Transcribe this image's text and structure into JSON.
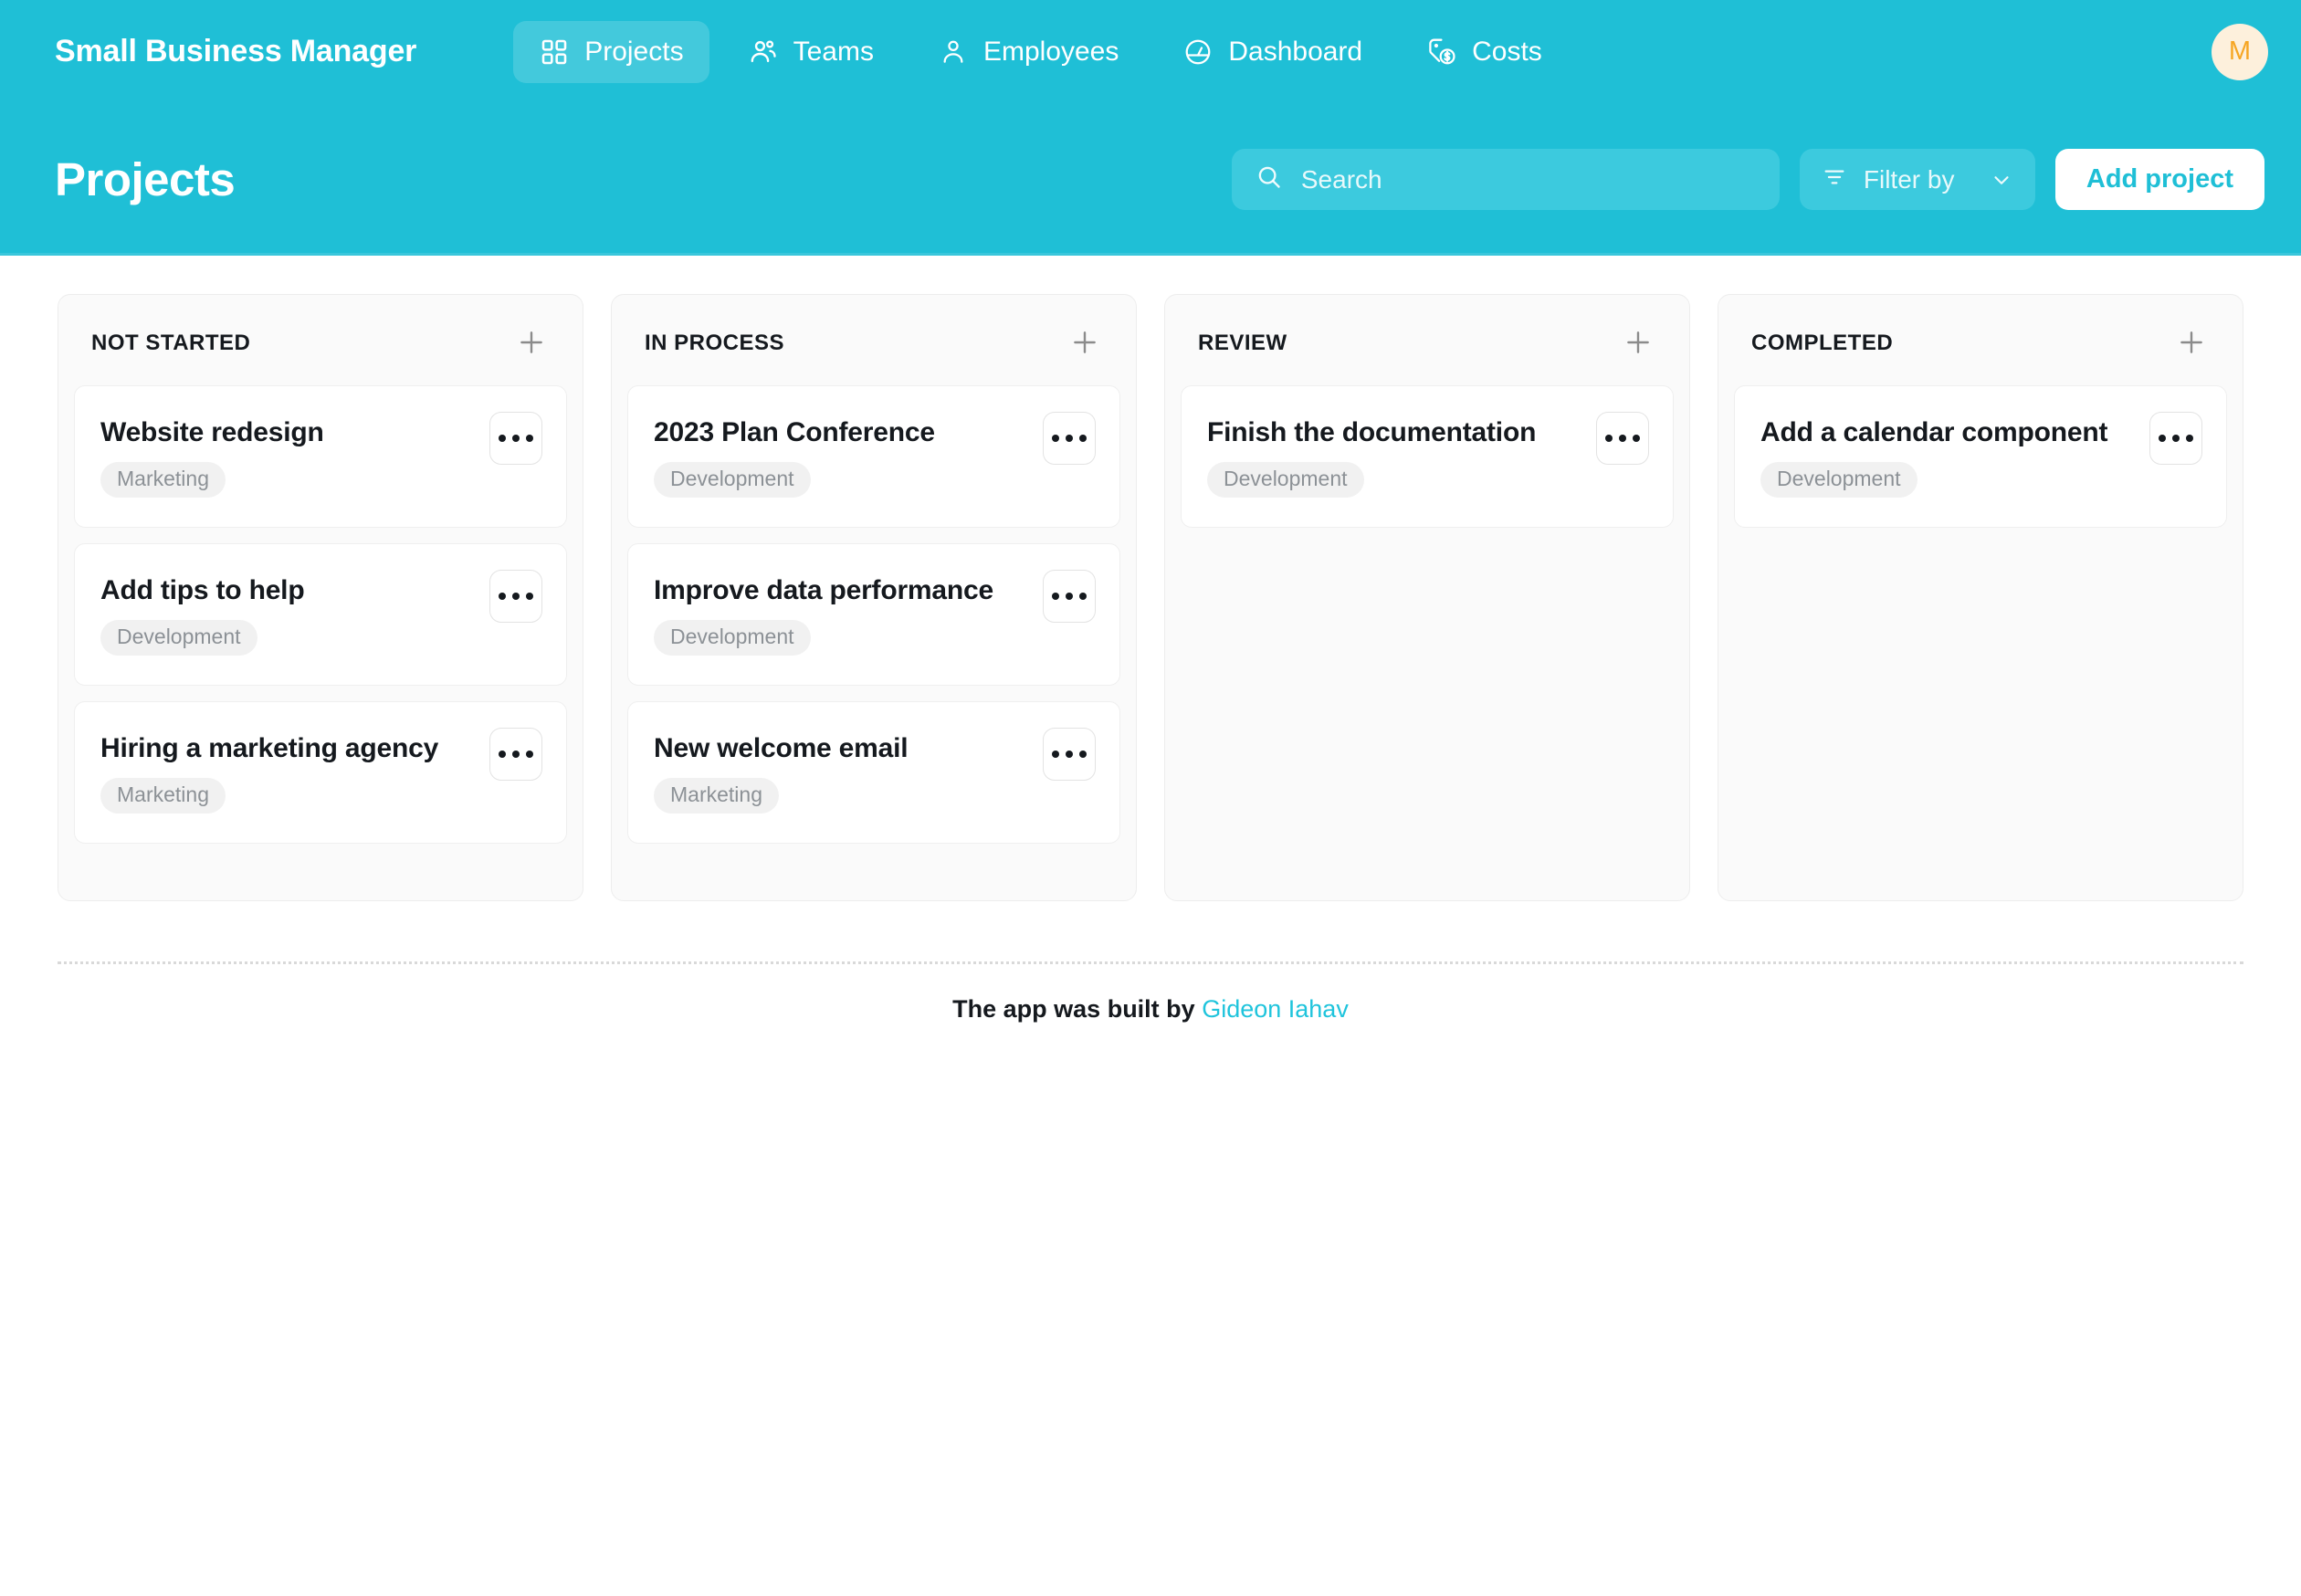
{
  "app": {
    "brand": "Small Business Manager",
    "accent_color": "#1FBFD6",
    "accent_light_color": "#3CCADE",
    "link_color": "#1FC4DC"
  },
  "nav": {
    "items": [
      {
        "label": "Projects",
        "icon": "grid-icon",
        "active": true
      },
      {
        "label": "Teams",
        "icon": "people-icon",
        "active": false
      },
      {
        "label": "Employees",
        "icon": "person-icon",
        "active": false
      },
      {
        "label": "Dashboard",
        "icon": "gauge-icon",
        "active": false
      },
      {
        "label": "Costs",
        "icon": "price-tag-icon",
        "active": false
      }
    ],
    "avatar": {
      "initial": "M",
      "bg_color": "#FDF0DC",
      "text_color": "#F6A623"
    }
  },
  "header": {
    "title": "Projects",
    "search": {
      "placeholder": "Search",
      "value": ""
    },
    "filter": {
      "label": "Filter by"
    },
    "add_button": {
      "label": "Add project"
    }
  },
  "board": {
    "columns": [
      {
        "title": "NOT STARTED",
        "cards": [
          {
            "title": "Website redesign",
            "tag": "Marketing"
          },
          {
            "title": "Add tips to help",
            "tag": "Development"
          },
          {
            "title": "Hiring a marketing agency",
            "tag": "Marketing"
          }
        ]
      },
      {
        "title": "IN PROCESS",
        "cards": [
          {
            "title": "2023 Plan Conference",
            "tag": "Development"
          },
          {
            "title": "Improve data performance",
            "tag": "Development"
          },
          {
            "title": "New welcome email",
            "tag": "Marketing"
          }
        ]
      },
      {
        "title": "REVIEW",
        "cards": [
          {
            "title": "Finish the documentation",
            "tag": "Development"
          }
        ]
      },
      {
        "title": "COMPLETED",
        "cards": [
          {
            "title": "Add a calendar component",
            "tag": "Development"
          }
        ]
      }
    ]
  },
  "footer": {
    "prefix": "The app was built by",
    "author": "Gideon Iahav"
  }
}
